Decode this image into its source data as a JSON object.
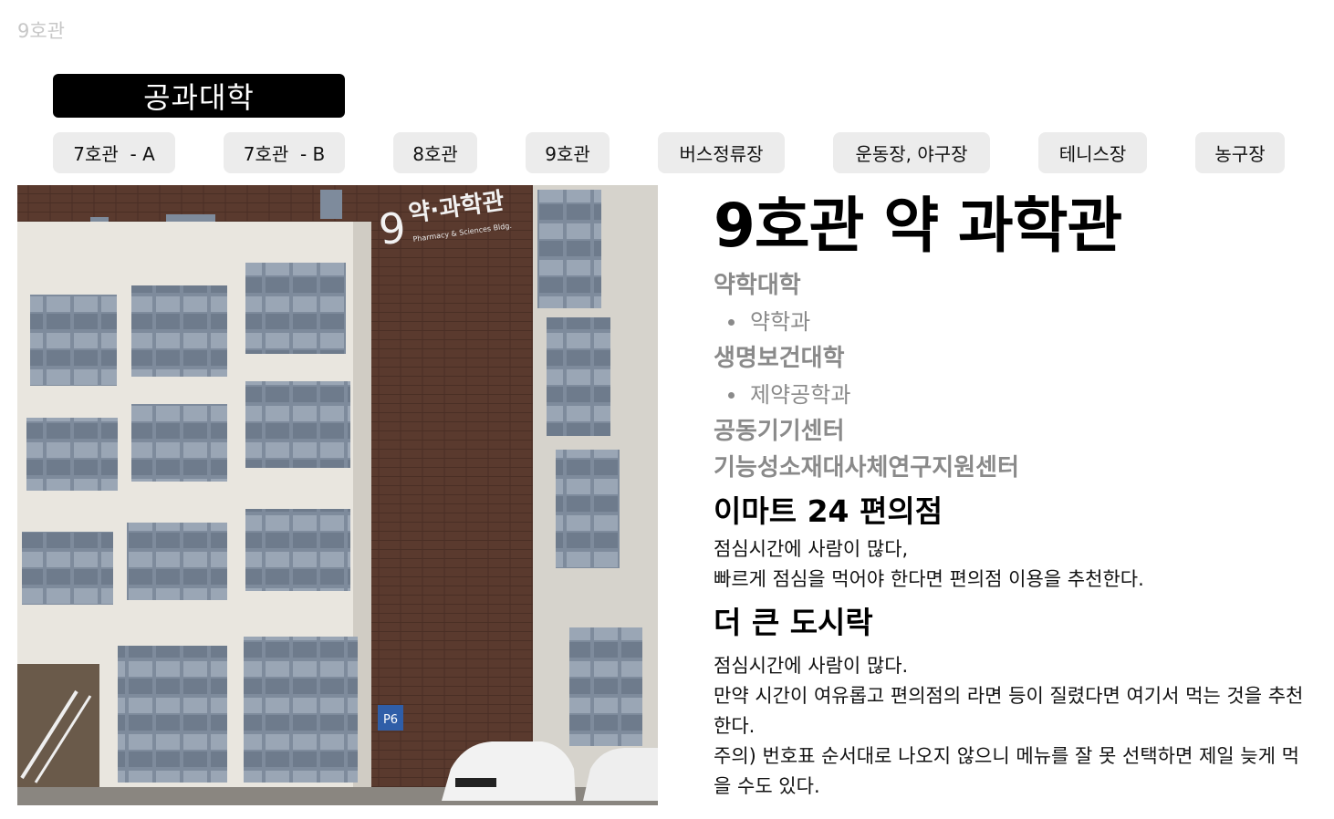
{
  "page_label": "9호관",
  "college_button": "공과대학",
  "tabs": [
    {
      "label": "7호관  - A"
    },
    {
      "label": "7호관  - B"
    },
    {
      "label": "8호관"
    },
    {
      "label": "9호관"
    },
    {
      "label": "버스정류장"
    },
    {
      "label": "운동장, 야구장"
    },
    {
      "label": "테니스장"
    },
    {
      "label": "농구장"
    }
  ],
  "photo": {
    "sign_number": "9",
    "sign_korean": "약·과학관",
    "sign_english": "Pharmacy & Sciences Bldg.",
    "parking_sign": "P6"
  },
  "building_title": "9호관 약 과학관",
  "colleges": [
    {
      "name": "약학대학",
      "departments": [
        "약학과"
      ]
    },
    {
      "name": "생명보건대학",
      "departments": [
        "제약공학과"
      ]
    },
    {
      "name": "공동기기센터",
      "departments": []
    },
    {
      "name": "기능성소재대사체연구지원센터",
      "departments": []
    }
  ],
  "facilities": [
    {
      "name": "이마트 24 편의점",
      "lines": [
        "점심시간에 사람이 많다,",
        "빠르게 점심을 먹어야 한다면 편의점 이용을 추천한다."
      ]
    },
    {
      "name": "더 큰 도시락",
      "lines": [
        "점심시간에 사람이 많다.",
        "만약 시간이 여유롭고 편의점의 라면 등이 질렸다면 여기서 먹는 것을 추천한다.",
        "주의) 번호표 순서대로 나오지 않으니 메뉴를 잘 못 선택하면 제일 늦게 먹을 수도 있다."
      ]
    }
  ]
}
